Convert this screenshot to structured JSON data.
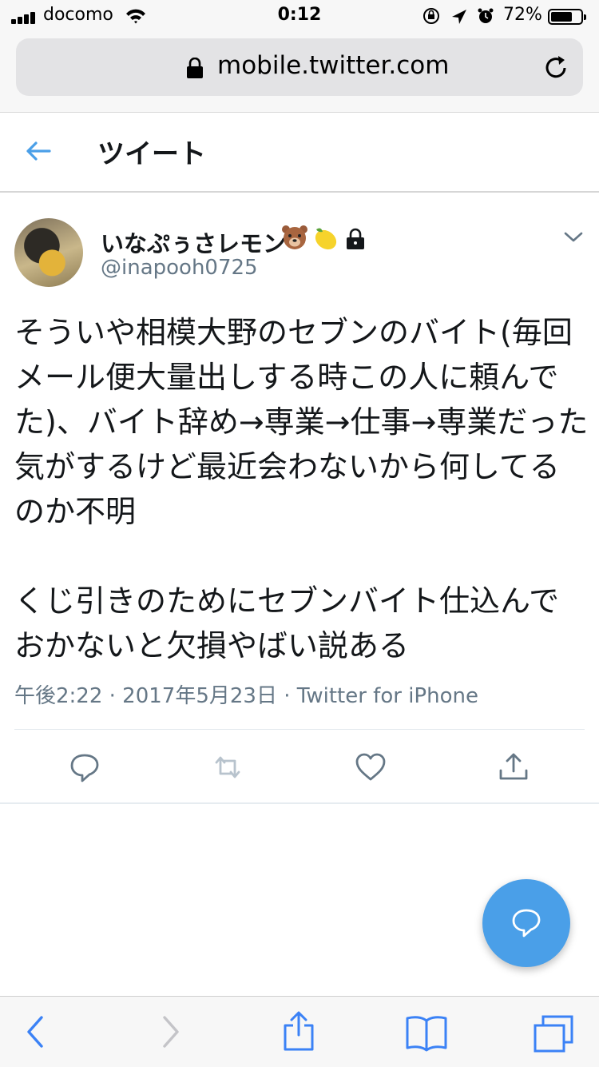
{
  "status_bar": {
    "carrier": "docomo",
    "time": "0:12",
    "battery_percent": "72%",
    "battery_level": 0.72
  },
  "browser": {
    "url": "mobile.twitter.com"
  },
  "header": {
    "title": "ツイート"
  },
  "tweet": {
    "display_name": "いなぷぅさレモン",
    "badges": [
      "bear-face-emoji",
      "lemon-emoji",
      "lock-icon"
    ],
    "handle": "@inapooh0725",
    "text": "そういや相模大野のセブンのバイト(毎回メール便大量出しする時この人に頼んでた)、バイト辞め→専業→仕事→専業だった気がするけど最近会わないから何してるのか不明\n\nくじ引きのためにセブンバイト仕込んでおかないと欠損やばい説ある",
    "meta": "午後2:22 · 2017年5月23日 · Twitter for iPhone"
  },
  "colors": {
    "accent": "#4a9fe8",
    "secondary_text": "#657786"
  }
}
